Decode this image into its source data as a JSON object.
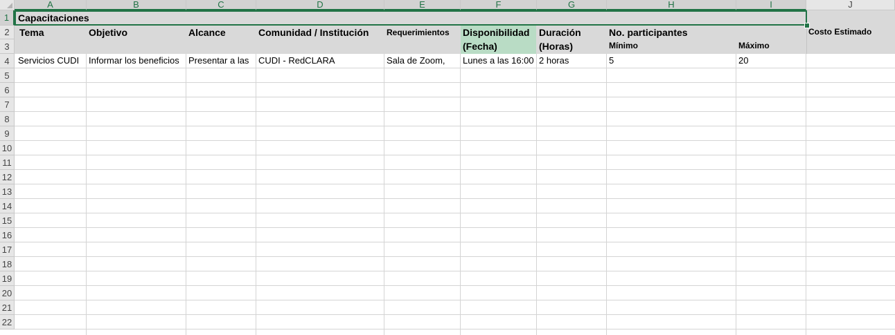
{
  "columns": [
    "A",
    "B",
    "C",
    "D",
    "E",
    "F",
    "G",
    "H",
    "I",
    "J"
  ],
  "rows": [
    "1",
    "2",
    "3",
    "4",
    "5",
    "6",
    "7",
    "8",
    "9",
    "10",
    "11",
    "12",
    "13",
    "14",
    "15",
    "16",
    "17",
    "18",
    "19",
    "20",
    "21",
    "22"
  ],
  "title": "Capacitaciones",
  "headers": {
    "tema": "Tema",
    "objetivo": "Objetivo",
    "alcance": "Alcance",
    "comunidad": "Comunidad / Institución",
    "requerimientos": "Requerimientos",
    "disponibilidad": "Disponibilidad",
    "fecha": "(Fecha)",
    "duracion": "Duración",
    "horas": "(Horas)",
    "participantes": "No. participantes",
    "minimo": "Mínimo",
    "maximo": "Máximo",
    "costo": "Costo Estimado"
  },
  "row4": {
    "tema": "Servicios CUDI",
    "objetivo": "Informar los beneficios",
    "alcance": "Presentar a las",
    "comunidad": "CUDI - RedCLARA",
    "requerimientos": "Sala de Zoom,",
    "disponibilidad": "Lunes a las 16:00",
    "duracion": "2 horas",
    "minimo": "5",
    "maximo": "20"
  },
  "colors": {
    "accent": "#217346",
    "header_band": "#d9d9d9",
    "highlight": "#b9dcc5"
  }
}
